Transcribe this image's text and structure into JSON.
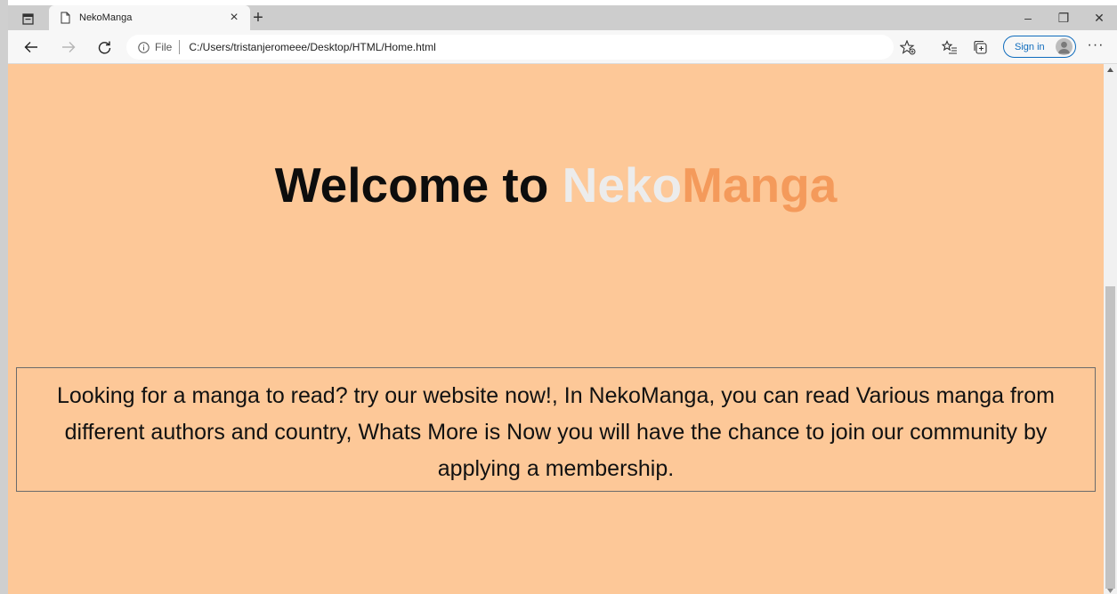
{
  "browser": {
    "tab_title": "NekoManga",
    "tab_close": "×",
    "new_tab": "+",
    "window_controls": {
      "minimize": "–",
      "restore": "❐",
      "close": "✕"
    },
    "address_scheme": "File",
    "address_url": "C:/Users/tristanjeromeee/Desktop/HTML/Home.html",
    "signin_label": "Sign in",
    "more_label": "···",
    "icons": [
      "tab-actions-icon",
      "page-icon",
      "back-arrow-icon",
      "forward-arrow-icon",
      "refresh-icon",
      "info-icon",
      "favorite-add-icon",
      "favorites-icon",
      "collections-icon",
      "avatar-icon",
      "more-icon"
    ]
  },
  "page": {
    "heading_prefix": "Welcome to ",
    "brand_part1": "Neko",
    "brand_part2": "Manga",
    "intro_text": "Looking for a manga to read? try our website now!, In NekoManga, you can read Various manga from different authors and country, Whats More is Now you will have the chance to join our community by applying a membership."
  },
  "colors": {
    "page_background": "#fdc898",
    "brand_part1": "#ececec",
    "brand_part2": "#f49a5b",
    "signin_accent": "#0f6cbd"
  },
  "scroll": {
    "position_fraction": 0.5
  }
}
